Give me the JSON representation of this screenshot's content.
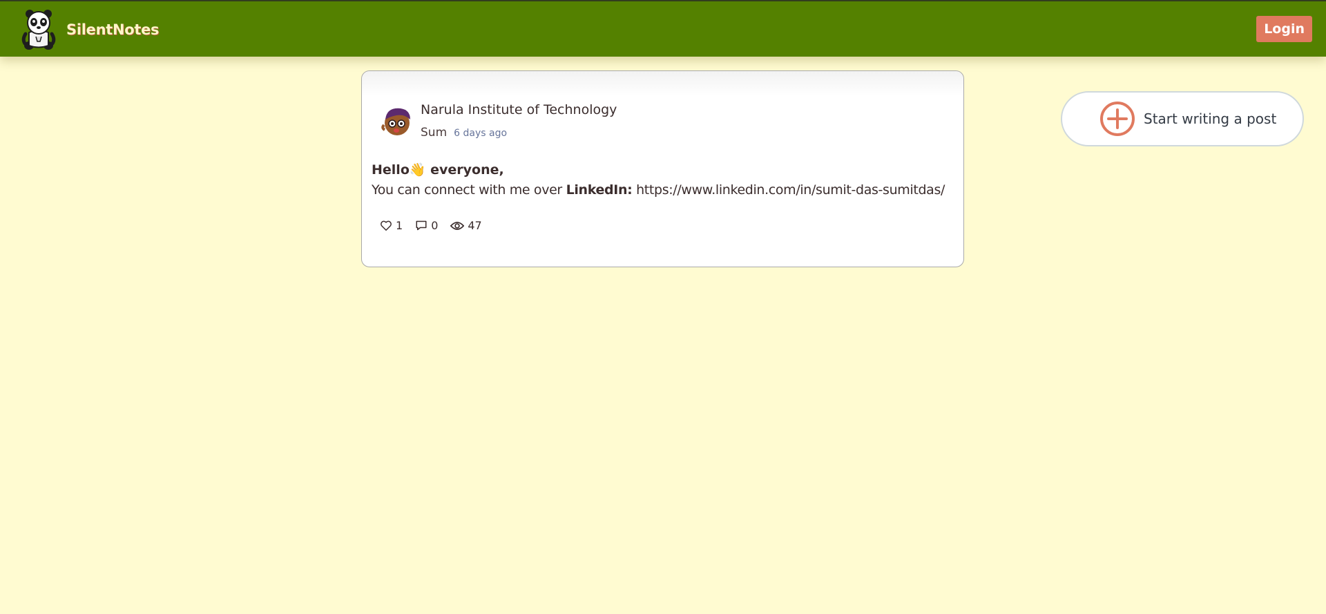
{
  "navbar": {
    "brand": "SilentNotes",
    "logo_icon": "panda-logo-icon",
    "login_label": "Login",
    "background": "#548100",
    "login_color": "#e07a5f"
  },
  "post": {
    "organization": "Narula Institute of Technology",
    "author": "Sum",
    "time_ago": "6 days ago",
    "greeting": "Hello👋 everyone,",
    "line_prefix": "You can connect with me over ",
    "line_bold": "LinkedIn:",
    "line_link": " https://www.linkedin.com/in/sumit-das-sumitdas/",
    "likes": "1",
    "comments": "0",
    "views": "47"
  },
  "composer": {
    "label": "Start writing a post",
    "icon": "plus-circle-icon"
  },
  "colors": {
    "page_background": "#fffbd1",
    "accent": "#e07a5f"
  }
}
